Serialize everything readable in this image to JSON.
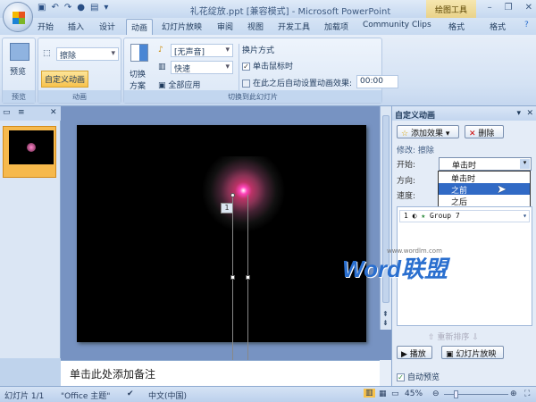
{
  "titlebar": {
    "title": "礼花绽放.ppt [兼容模式] - Microsoft PowerPoint",
    "context_tab": "绘图工具",
    "qat": [
      "save-icon",
      "undo-icon",
      "redo-icon",
      "circle-icon",
      "print-icon",
      "▾"
    ]
  },
  "tabs": [
    "开始",
    "插入",
    "设计",
    "动画",
    "幻灯片放映",
    "审阅",
    "视图",
    "开发工具",
    "加载项",
    "Community Clips",
    "格式",
    "格式"
  ],
  "ribbon": {
    "preview": {
      "button": "预览",
      "label": "预览"
    },
    "animation": {
      "effect": "擦除",
      "custom": "自定义动画",
      "label": "动画"
    },
    "transition": {
      "scheme": "切换",
      "scheme2": "方案",
      "sound": "[无声音]",
      "speed": "快速",
      "apply_all": "全部应用",
      "mode_title": "换片方式",
      "on_click": "单击鼠标时",
      "auto_after": "在此之后自动设置动画效果:",
      "time": "00:00",
      "label": "切换到此幻灯片"
    }
  },
  "slide": {
    "marker": "1",
    "watermark": "Word联盟",
    "watermark_url": "www.wordlm.com"
  },
  "notes": {
    "placeholder": "单击此处添加备注"
  },
  "pane": {
    "title": "自定义动画",
    "add_effect": "添加效果",
    "remove": "删除",
    "modify": "修改: 擦除",
    "start_label": "开始:",
    "start_value": "单击时",
    "direction_label": "方向:",
    "speed_label": "速度:",
    "options": [
      "单击时",
      "之前",
      "之后"
    ],
    "selected_option": "之前",
    "item": {
      "index": "1",
      "name": "Group 7"
    },
    "reorder": "重新排序",
    "play": "播放",
    "slideshow": "幻灯片放映",
    "autopreview": "自动预览"
  },
  "status": {
    "slide": "幻灯片 1/1",
    "theme": "\"Office 主题\"",
    "language": "中文(中国)",
    "zoom": "45%"
  }
}
